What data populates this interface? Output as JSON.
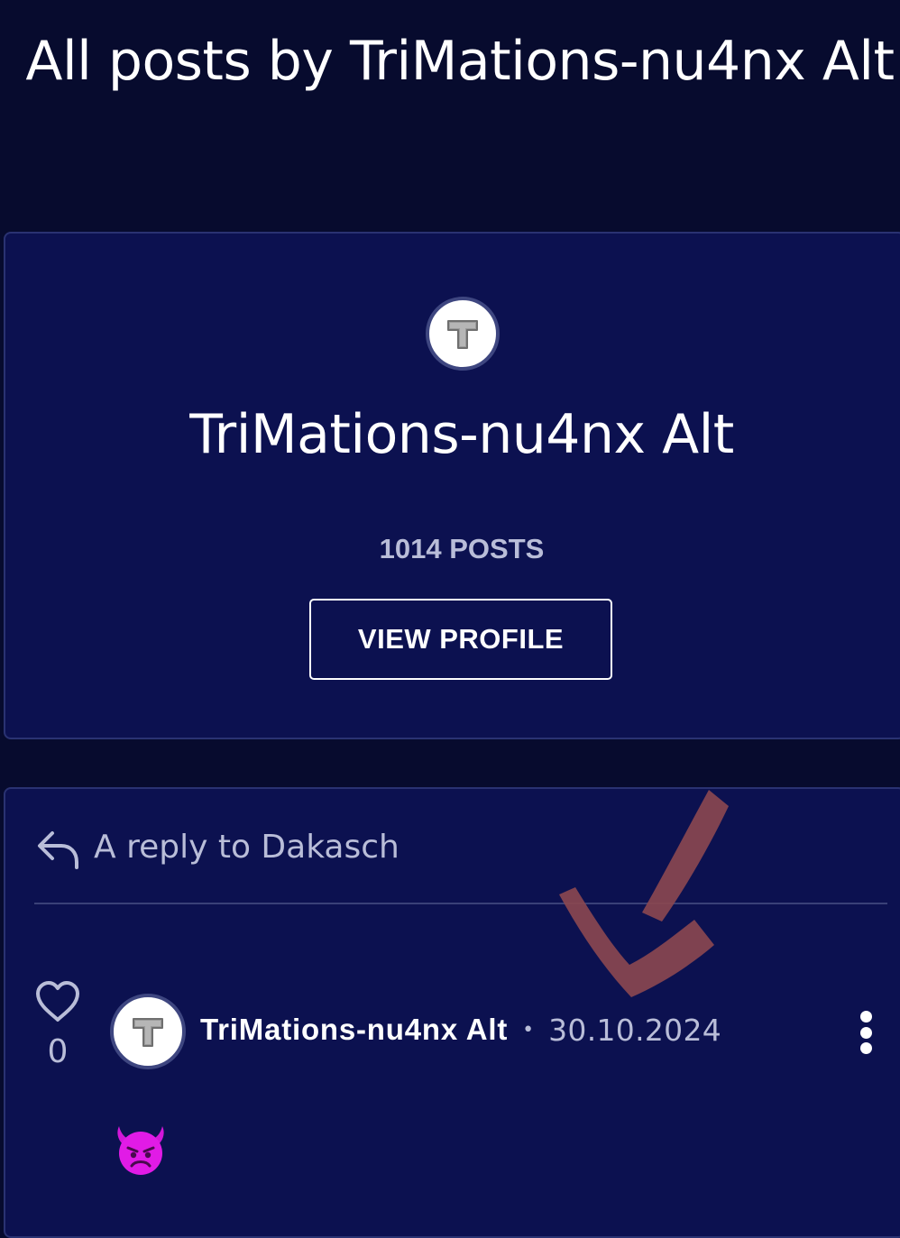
{
  "page": {
    "title": "All posts by TriMations-nu4nx Alt"
  },
  "profile": {
    "avatar_letter": "T",
    "name": "TriMations-nu4nx Alt",
    "post_count_label": "1014 POSTS",
    "view_profile_label": "VIEW PROFILE"
  },
  "post": {
    "reply_to_text": "A reply to Dakasch",
    "like_count": "0",
    "avatar_letter": "T",
    "author": "TriMations-nu4nx Alt",
    "separator": "•",
    "date": "30.10.2024",
    "content_icon": "smiling-devil-emoji-icon"
  },
  "colors": {
    "background": "#070b2e",
    "card": "#0c1150",
    "card_border": "#2a3272",
    "muted_text": "#b9bdd8",
    "checkmark": "#8a4650",
    "emoji": "#e11be6"
  }
}
